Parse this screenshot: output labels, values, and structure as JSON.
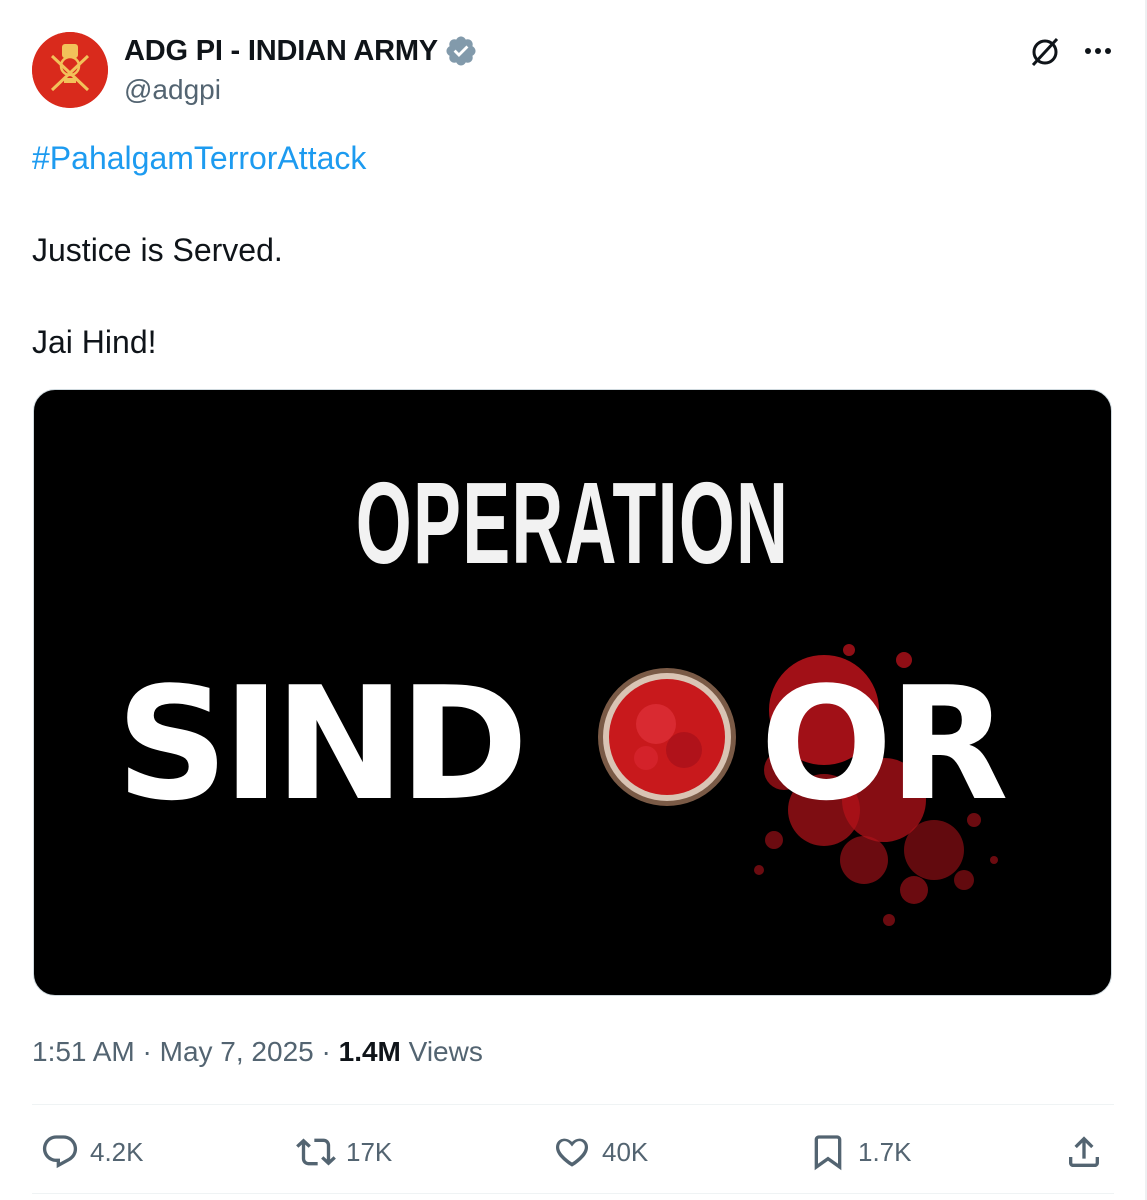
{
  "author": {
    "display_name": "ADG PI - INDIAN ARMY",
    "handle": "@adgpi"
  },
  "tweet": {
    "hashtag": "#PahalgamTerrorAttack",
    "line1": "Justice is Served.",
    "line2": "Jai Hind!"
  },
  "media": {
    "title_top": "OPERATION",
    "title_left": "SIND",
    "title_right": "OR"
  },
  "meta": {
    "time": "1:51 AM",
    "sep1": " · ",
    "date": "May 7, 2025",
    "sep2": " · ",
    "views_count": "1.4M",
    "views_label": " Views"
  },
  "actions": {
    "replies": "4.2K",
    "reposts": "17K",
    "likes": "40K",
    "bookmarks": "1.7K"
  },
  "icons": [
    "verified-badge-icon",
    "grok-icon",
    "more-icon",
    "reply-icon",
    "repost-icon",
    "like-icon",
    "bookmark-icon",
    "share-icon"
  ],
  "colors": {
    "link": "#1d9bf0",
    "secondary_text": "#536471",
    "verified": "#829aab",
    "avatar_bg": "#d92a1c"
  }
}
